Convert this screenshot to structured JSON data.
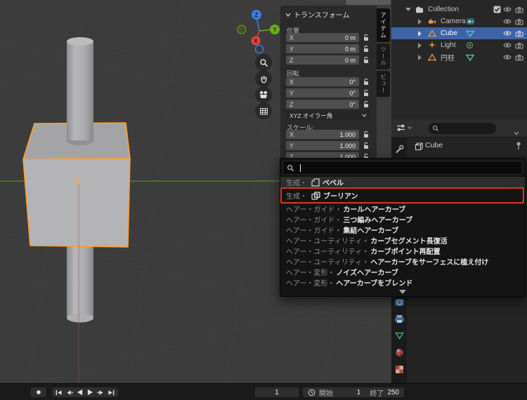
{
  "colors": {
    "accent_orange": "#ff9d2e",
    "selection_blue": "#3d64a5",
    "annotation_red": "#d23b22",
    "axis_green": "#63913a",
    "axis_red": "#a34a44",
    "gizmo_x": "#e0433d",
    "gizmo_y": "#71a91c",
    "gizmo_z": "#3d7de0"
  },
  "viewport": {
    "gizmo": {
      "x_label": "X",
      "y_label": "Y",
      "z_label": "Z"
    },
    "tools": [
      "zoom",
      "pan",
      "camera-view",
      "orthographic-toggle"
    ]
  },
  "transform_panel": {
    "title": "トランスフォーム",
    "side_tabs": [
      {
        "label": "アイテム",
        "active": true
      },
      {
        "label": "ツール",
        "active": false
      },
      {
        "label": "ビュー",
        "active": false
      }
    ],
    "position": {
      "label": "位置",
      "rows": [
        {
          "axis": "X",
          "value": "0 m"
        },
        {
          "axis": "Y",
          "value": "0 m"
        },
        {
          "axis": "Z",
          "value": "0 m"
        }
      ]
    },
    "rotation": {
      "label": "回転",
      "rows": [
        {
          "axis": "X",
          "value": "0°"
        },
        {
          "axis": "Y",
          "value": "0°"
        },
        {
          "axis": "Z",
          "value": "0°"
        }
      ]
    },
    "rotation_mode": "XYZ オイラー角",
    "scale": {
      "label": "スケール:",
      "rows": [
        {
          "axis": "X",
          "value": "1.000"
        },
        {
          "axis": "Y",
          "value": "1.000"
        },
        {
          "axis": "Z",
          "value": "1.000"
        }
      ]
    }
  },
  "outliner": {
    "items": [
      {
        "label": "Collection",
        "type": "collection"
      },
      {
        "label": "Camera",
        "type": "camera"
      },
      {
        "label": "Cube",
        "type": "mesh",
        "selected": true
      },
      {
        "label": "Light",
        "type": "light"
      },
      {
        "label": "円柱",
        "type": "mesh"
      }
    ]
  },
  "properties": {
    "object_name": "Cube",
    "search_value": ""
  },
  "modifier_menu": {
    "search_value": "",
    "items": [
      {
        "prefix": "生成・",
        "label": "ベベル",
        "icon": "bevel"
      },
      {
        "prefix": "生成・",
        "label": "ブーリアン",
        "icon": "boolean",
        "annotated": true
      },
      {
        "prefix": "ヘアー・ガイド・",
        "label": "カールヘアーカーブ"
      },
      {
        "prefix": "ヘアー・ガイド・",
        "label": "三つ編みヘアーカーブ"
      },
      {
        "prefix": "ヘアー・ガイド・",
        "label": "集結ヘアーカーブ"
      },
      {
        "prefix": "ヘアー・ユーティリティ・",
        "label": "カーブセグメント長復活"
      },
      {
        "prefix": "ヘアー・ユーティリティ・",
        "label": "カーブポイント再配置"
      },
      {
        "prefix": "ヘアー・ユーティリティ・",
        "label": "ヘアーカーブをサーフェスに植え付け"
      },
      {
        "prefix": "ヘアー・変形・",
        "label": "ノイズヘアーカーブ"
      },
      {
        "prefix": "ヘアー・変形・",
        "label": "ヘアーカーブをブレンド"
      }
    ]
  },
  "timeline": {
    "current_frame": "1",
    "start_label": "開始",
    "start_value": "1",
    "end_label": "終了",
    "end_value": "250"
  }
}
